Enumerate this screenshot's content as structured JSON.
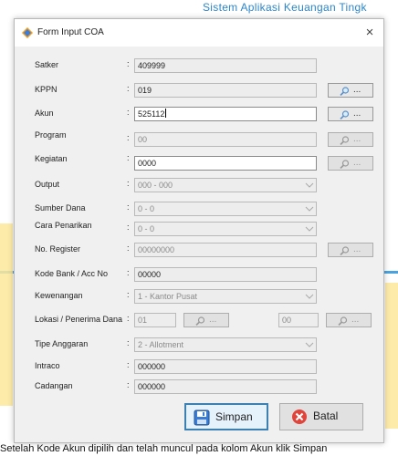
{
  "document": {
    "header_text": "Sistem Aplikasi Keuangan Tingk",
    "caption": "Setelah Kode Akun dipilih dan telah muncul pada kolom Akun klik Simpan",
    "colors": {
      "header_text": "#2e86c8",
      "stripe": "#4aa3df",
      "accent": "#fde79a"
    }
  },
  "dialog": {
    "title": "Form Input COA",
    "close_label": "×",
    "colon": ":",
    "browse_label": "...",
    "fields": {
      "satker": {
        "label": "Satker",
        "value": "409999"
      },
      "kppn": {
        "label": "KPPN",
        "value": "019"
      },
      "akun": {
        "label": "Akun",
        "value": "525112"
      },
      "program": {
        "label": "Program",
        "value": "00"
      },
      "kegiatan": {
        "label": "Kegiatan",
        "value": "0000"
      },
      "output": {
        "label": "Output",
        "value": "000 - 000"
      },
      "sumber_dana": {
        "label": "Sumber Dana",
        "value": "0 - 0"
      },
      "cara_penarikan": {
        "label": "Cara Penarikan",
        "value": "0 - 0"
      },
      "no_register": {
        "label": "No. Register",
        "value": "00000000"
      },
      "kode_bank": {
        "label": "Kode Bank / Acc No",
        "value": "00000"
      },
      "kewenangan": {
        "label": "Kewenangan",
        "value": "1 - Kantor Pusat"
      },
      "lokasi": {
        "label": "Lokasi / Penerima Dana",
        "value": "01",
        "value2": "00"
      },
      "tipe_anggaran": {
        "label": "Tipe Anggaran",
        "value": "2 - Allotment"
      },
      "intraco": {
        "label": "Intraco",
        "value": "000000"
      },
      "cadangan": {
        "label": "Cadangan",
        "value": "000000"
      }
    },
    "buttons": {
      "simpan": "Simpan",
      "batal": "Batal"
    },
    "colors": {
      "primary_border": "#3c7fb1",
      "batal_icon": "#e0443a",
      "simpan_icon": "#3a7bd5"
    }
  }
}
